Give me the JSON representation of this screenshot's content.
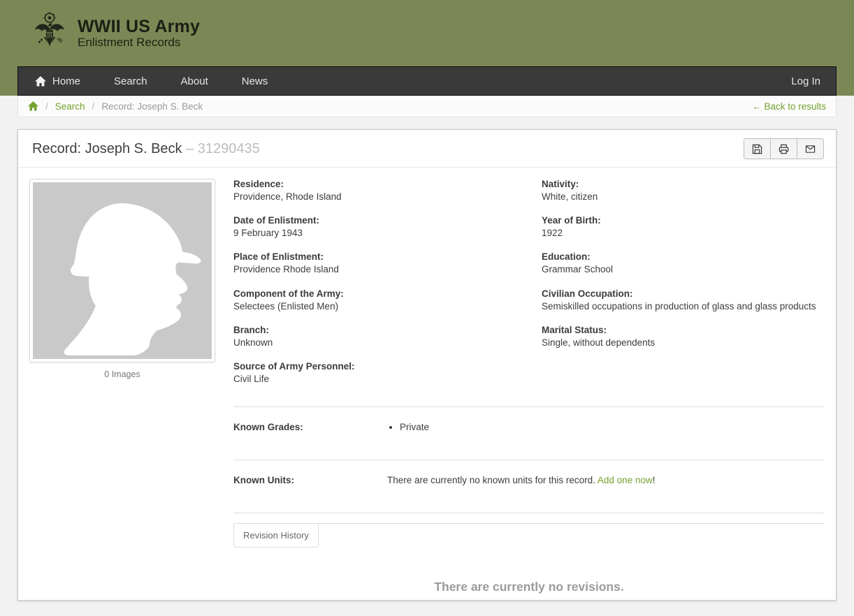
{
  "branding": {
    "title": "WWII US Army",
    "subtitle": "Enlistment Records"
  },
  "navbar": {
    "items": [
      "Home",
      "Search",
      "About",
      "News"
    ],
    "login_label": "Log In"
  },
  "breadcrumb": {
    "separator": "/",
    "search_label": "Search",
    "current": "Record: Joseph S. Beck",
    "back_label": "← Back to results"
  },
  "record": {
    "title": "Record: Joseph S. Beck",
    "id_suffix": "– 31290435",
    "images_caption": "0 Images",
    "fields_left": [
      {
        "label": "Residence:",
        "value": "Providence, Rhode Island"
      },
      {
        "label": "Date of Enlistment:",
        "value": "9 February 1943"
      },
      {
        "label": "Place of Enlistment:",
        "value": "Providence Rhode Island"
      },
      {
        "label": "Component of the Army:",
        "value": "Selectees (Enlisted Men)"
      },
      {
        "label": "Branch:",
        "value": "Unknown"
      },
      {
        "label": "Source of Army Personnel:",
        "value": "Civil Life"
      }
    ],
    "fields_right": [
      {
        "label": "Nativity:",
        "value": "White, citizen"
      },
      {
        "label": "Year of Birth:",
        "value": "1922"
      },
      {
        "label": "Education:",
        "value": "Grammar School"
      },
      {
        "label": "Civilian Occupation:",
        "value": "Semiskilled occupations in production of glass and glass products"
      },
      {
        "label": "Marital Status:",
        "value": "Single, without dependents"
      }
    ],
    "grades": {
      "label": "Known Grades:",
      "items": [
        "Private"
      ]
    },
    "units": {
      "label": "Known Units:",
      "empty_text": "There are currently no known units for this record.",
      "link_label": "Add one now",
      "link_suffix": "!"
    },
    "revision_tab_label": "Revision History",
    "revisions_empty": "There are currently no revisions."
  },
  "icons": {
    "logo": "army-eagle-seal-icon",
    "nav_home": "home-icon",
    "crumb_home": "home-icon",
    "actions": [
      "save-icon",
      "print-icon",
      "email-icon"
    ],
    "placeholder_image": "soldier-silhouette-icon"
  },
  "colors": {
    "header_green": "#7b8856",
    "navbar_dark": "#3a3a3a",
    "accent_green": "#76a22e",
    "page_background": "#f2f2f2",
    "muted_text": "#9a9a9a"
  }
}
